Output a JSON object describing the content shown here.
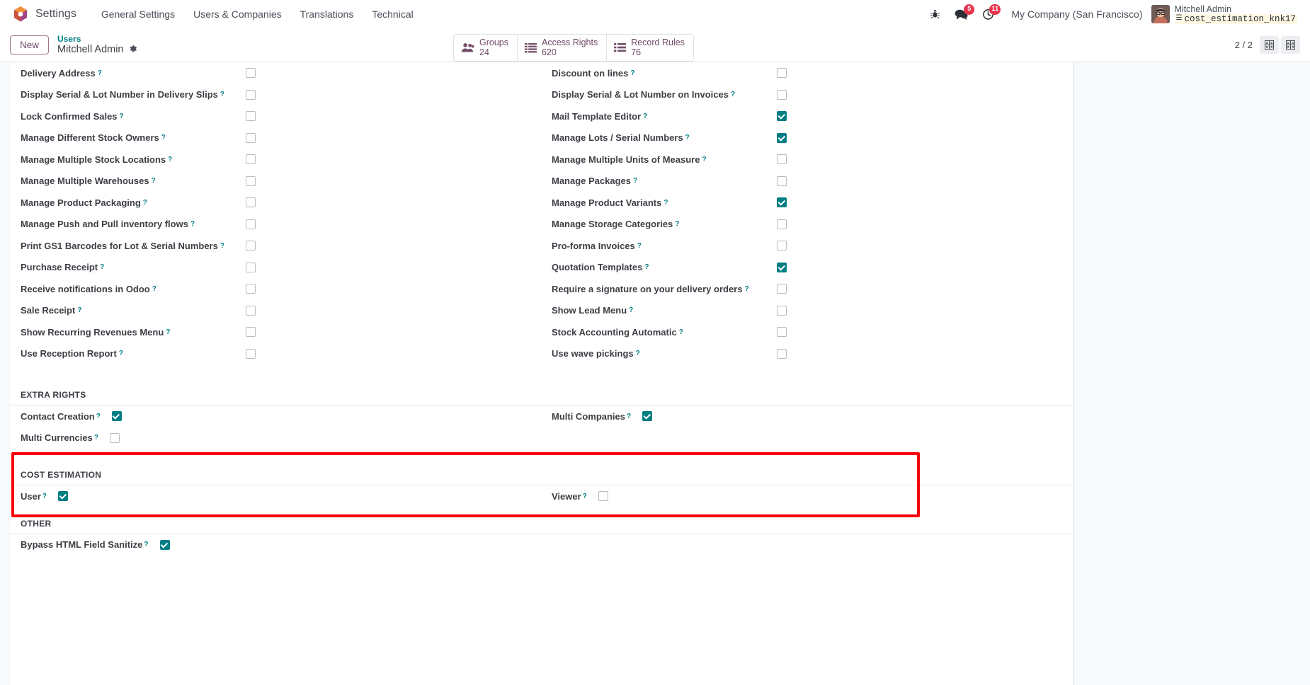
{
  "navbar": {
    "brand": "Settings",
    "menu": [
      "General Settings",
      "Users & Companies",
      "Translations",
      "Technical"
    ],
    "icons": {
      "debug": "bug-icon",
      "messages": "chat-icon",
      "activities": "clock-icon"
    },
    "badges": {
      "messages": "5",
      "activities": "11"
    },
    "company": "My Company (San Francisco)",
    "user_name": "Mitchell Admin",
    "database": "cost_estimation_knk17"
  },
  "control_panel": {
    "new_label": "New",
    "breadcrumb_parent": "Users",
    "breadcrumb_current": "Mitchell Admin",
    "gear": "gear-icon",
    "stat_buttons": [
      {
        "label": "Groups",
        "value": "24",
        "icon": "users-icon"
      },
      {
        "label": "Access Rights",
        "value": "620",
        "icon": "list-icon"
      },
      {
        "label": "Record Rules",
        "value": "76",
        "icon": "list-bullet-icon"
      }
    ],
    "pager": "2 / 2",
    "view_buttons": [
      "list-view-icon",
      "form-view-icon"
    ]
  },
  "form": {
    "application_rights": {
      "left": [
        {
          "label": "Delivery Address",
          "checked": false
        },
        {
          "label": "Display Serial & Lot Number in Delivery Slips",
          "checked": false
        },
        {
          "label": "Lock Confirmed Sales",
          "checked": false
        },
        {
          "label": "Manage Different Stock Owners",
          "checked": false
        },
        {
          "label": "Manage Multiple Stock Locations",
          "checked": false
        },
        {
          "label": "Manage Multiple Warehouses",
          "checked": false
        },
        {
          "label": "Manage Product Packaging",
          "checked": false
        },
        {
          "label": "Manage Push and Pull inventory flows",
          "checked": false
        },
        {
          "label": "Print GS1 Barcodes for Lot & Serial Numbers",
          "checked": false
        },
        {
          "label": "Purchase Receipt",
          "checked": false
        },
        {
          "label": "Receive notifications in Odoo",
          "checked": false
        },
        {
          "label": "Sale Receipt",
          "checked": false
        },
        {
          "label": "Show Recurring Revenues Menu",
          "checked": false
        },
        {
          "label": "Use Reception Report",
          "checked": false
        }
      ],
      "right": [
        {
          "label": "Discount on lines",
          "checked": false
        },
        {
          "label": "Display Serial & Lot Number on Invoices",
          "checked": false
        },
        {
          "label": "Mail Template Editor",
          "checked": true
        },
        {
          "label": "Manage Lots / Serial Numbers",
          "checked": true
        },
        {
          "label": "Manage Multiple Units of Measure",
          "checked": false
        },
        {
          "label": "Manage Packages",
          "checked": false
        },
        {
          "label": "Manage Product Variants",
          "checked": true
        },
        {
          "label": "Manage Storage Categories",
          "checked": false
        },
        {
          "label": "Pro-forma Invoices",
          "checked": false
        },
        {
          "label": "Quotation Templates",
          "checked": true
        },
        {
          "label": "Require a signature on your delivery orders",
          "checked": false
        },
        {
          "label": "Show Lead Menu",
          "checked": false
        },
        {
          "label": "Stock Accounting Automatic",
          "checked": false
        },
        {
          "label": "Use wave pickings",
          "checked": false
        }
      ]
    },
    "extra_rights": {
      "title": "EXTRA RIGHTS",
      "left": [
        {
          "label": "Contact Creation",
          "checked": true
        },
        {
          "label": "Multi Currencies",
          "checked": false
        }
      ],
      "right": [
        {
          "label": "Multi Companies",
          "checked": true
        }
      ]
    },
    "cost_estimation": {
      "title": "COST ESTIMATION",
      "left": [
        {
          "label": "User",
          "checked": true
        }
      ],
      "right": [
        {
          "label": "Viewer",
          "checked": false
        }
      ]
    },
    "other": {
      "title": "OTHER",
      "left": [
        {
          "label": "Bypass HTML Field Sanitize",
          "checked": true
        }
      ],
      "right": []
    }
  },
  "colors": {
    "accent_teal": "#017e84",
    "brand_purple": "#714b67",
    "badge_red": "#e6334a",
    "highlight_red": "#fb0007"
  }
}
